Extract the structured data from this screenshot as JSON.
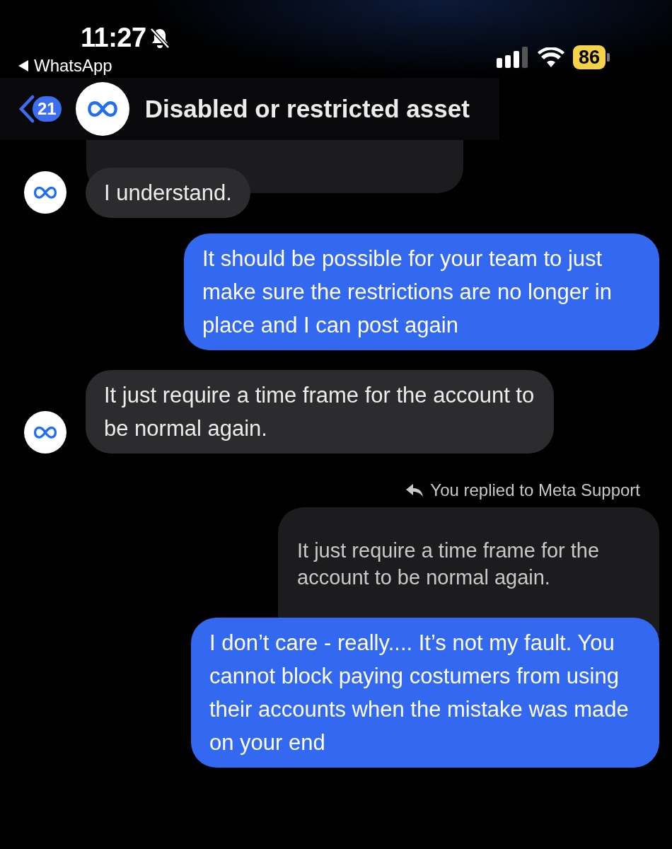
{
  "status_bar": {
    "time": "11:27",
    "back_app": "WhatsApp",
    "battery": "86"
  },
  "header": {
    "unread_count": "21",
    "title": "Disabled or restricted asset"
  },
  "messages": [
    {
      "kind": "truncated"
    },
    {
      "kind": "incoming",
      "text": "I understand."
    },
    {
      "kind": "outgoing",
      "text": "It should be possible for your team to just make sure the restrictions are no longer in place and I can post again"
    },
    {
      "kind": "incoming",
      "text": "It just require a time frame for the account to be normal again."
    },
    {
      "kind": "reply",
      "label": "You replied to Meta Support",
      "quote": "It just require a time frame for the account to be normal again.",
      "text": "I don’t care - really.... It’s not my fault. You cannot block paying costumers from using their accounts when the mistake was made on your end"
    }
  ]
}
